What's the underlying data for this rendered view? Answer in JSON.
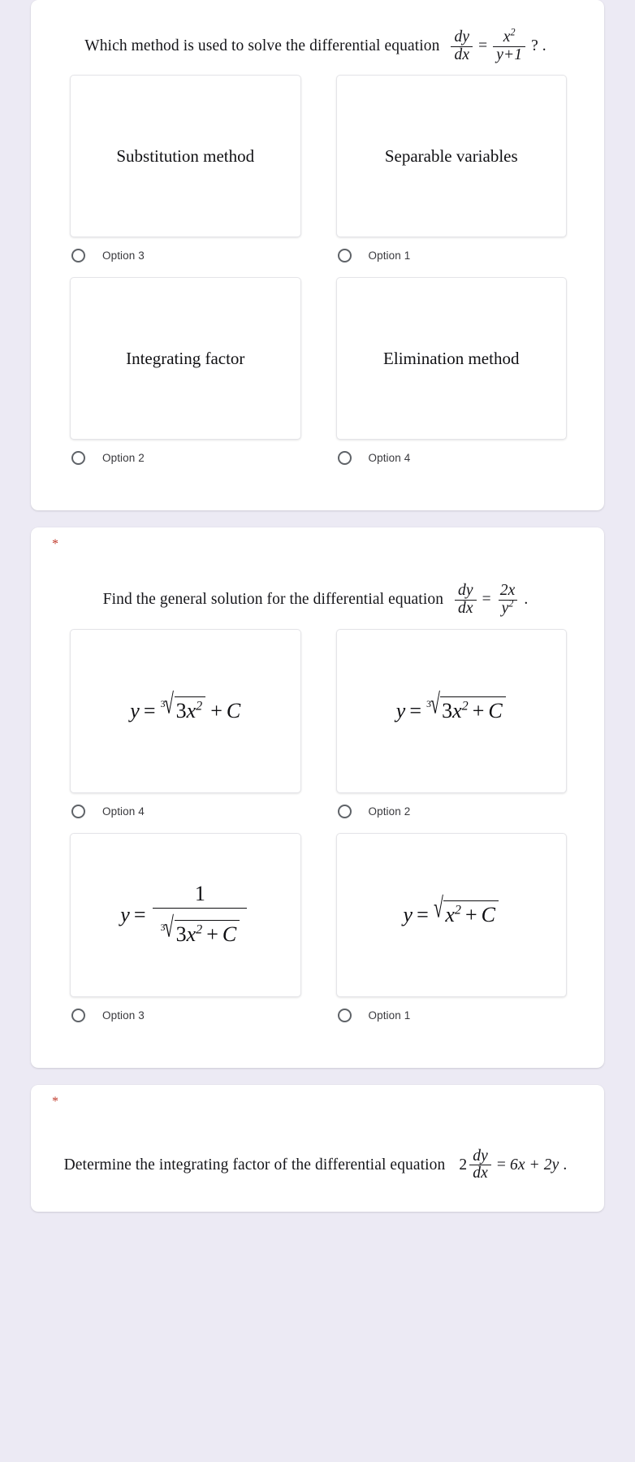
{
  "theme": {
    "page_background": "#eceaf4",
    "card_background": "#ffffff",
    "required_star_color": "#c0392b",
    "radio_border_color": "#5f6368",
    "label_text_color": "#39393d"
  },
  "questions": [
    {
      "id": "q1",
      "required_marker": "",
      "prompt": {
        "lead": "Which method is used to solve the differential equation",
        "equation": {
          "lhs_num": "dy",
          "lhs_den": "dx",
          "relation": "=",
          "rhs_num": "x",
          "rhs_num_exp": "2",
          "rhs_den": "y+1"
        },
        "trail": "? ."
      },
      "options": [
        {
          "image_text": "Substitution method",
          "radio_label": "Option 3"
        },
        {
          "image_text": "Separable variables",
          "radio_label": "Option 1"
        },
        {
          "image_text": "Integrating factor",
          "radio_label": "Option 2"
        },
        {
          "image_text": "Elimination method",
          "radio_label": "Option 4"
        }
      ]
    },
    {
      "id": "q2",
      "required_marker": "*",
      "prompt": {
        "lead": "Find the general solution for  the  differential equation",
        "equation": {
          "lhs_num": "dy",
          "lhs_den": "dx",
          "relation": "=",
          "rhs_num": "2x",
          "rhs_den": "y",
          "rhs_den_exp": "2"
        },
        "trail": "."
      },
      "options": [
        {
          "formula": "y = cbrt(3x^2) + C",
          "radio_label": "Option 4"
        },
        {
          "formula": "y = cbrt(3x^2 + C)",
          "radio_label": "Option 2"
        },
        {
          "formula": "y = 1 / cbrt(3x^2 + C)",
          "radio_label": "Option 3"
        },
        {
          "formula": "y = sqrt(x^2 + C)",
          "radio_label": "Option 1"
        }
      ],
      "math_tokens": {
        "y": "y",
        "equals": "=",
        "plus": "+",
        "index3": "3",
        "radical": "√",
        "three": "3",
        "x": "x",
        "exp2": "2",
        "C": "C",
        "one": "1"
      }
    },
    {
      "id": "q3",
      "required_marker": "*",
      "prompt": {
        "lead": "Determine the integrating factor of the  differential equation",
        "equation": {
          "coefficient": "2",
          "lhs_num": "dy",
          "lhs_den": "dx",
          "relation": "=",
          "rhs": "6x + 2y"
        },
        "trail": "."
      }
    }
  ]
}
